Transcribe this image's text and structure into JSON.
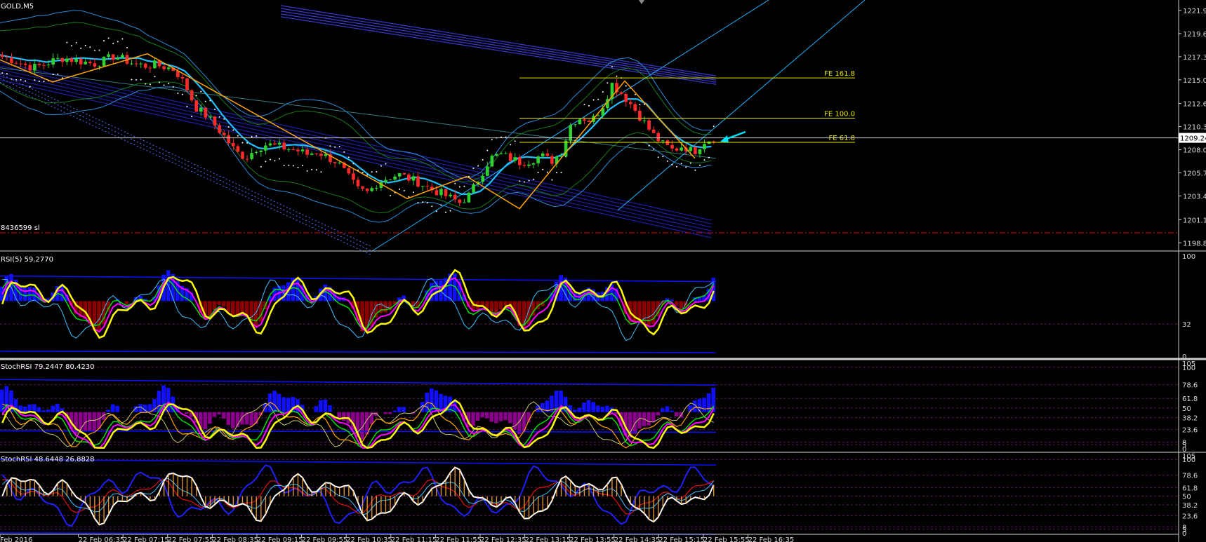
{
  "symbol_label": "GOLD,M5",
  "current_price": "1209.24",
  "sl_label": "8436599 sl",
  "colors": {
    "bull": "#2ed12e",
    "bear": "#ff2b2b",
    "fib": "#e8e800",
    "cyan": "#1fb3ff",
    "navy": "#2323c9",
    "yellow": "#ffff00",
    "magenta": "#ff00ff",
    "green": "#00e000",
    "histBlue": "#1010ff",
    "histRed": "#8a0000",
    "histPurple": "#8a008a",
    "orange": "#ffa400"
  },
  "fib_levels": [
    {
      "label": "FE 161.8",
      "price": 1215.2
    },
    {
      "label": "FE 100.0",
      "price": 1211.2
    },
    {
      "label": "FE 61.8",
      "price": 1208.8
    }
  ],
  "chart_data": [
    {
      "type": "candlestick",
      "title": "GOLD,M5",
      "y_ticks": [
        "1221.91",
        "1219.61",
        "1217.31",
        "1215.01",
        "1212.66",
        "1210.36",
        "1208.06",
        "1205.76",
        "1203.46",
        "1201.11",
        "1198.81"
      ],
      "ylim": [
        1198.81,
        1221.91
      ],
      "x_ticks": [
        "Feb 2016",
        "22 Feb 06:35",
        "22 Feb 07:15",
        "22 Feb 07:55",
        "22 Feb 08:35",
        "22 Feb 09:15",
        "22 Feb 09:55",
        "22 Feb 10:35",
        "22 Feb 11:15",
        "22 Feb 11:55",
        "22 Feb 12:35",
        "22 Feb 13:15",
        "22 Feb 13:55",
        "22 Feb 14:35",
        "22 Feb 15:15",
        "22 Feb 15:55",
        "22 Feb 16:35"
      ],
      "close_path": [
        1217.3,
        1217.0,
        1216.6,
        1216.2,
        1216.5,
        1216.9,
        1217.2,
        1217.0,
        1216.8,
        1216.6,
        1216.9,
        1217.4,
        1217.0,
        1216.6,
        1216.4,
        1216.5,
        1216.3,
        1216.0,
        1214.5,
        1212.3,
        1211.5,
        1210.4,
        1209.2,
        1207.8,
        1207.3,
        1208.2,
        1208.6,
        1208.4,
        1208.2,
        1208.0,
        1207.6,
        1207.9,
        1207.3,
        1206.8,
        1205.4,
        1204.1,
        1203.8,
        1204.9,
        1205.3,
        1205.6,
        1205.2,
        1204.8,
        1204.2,
        1203.8,
        1203.3,
        1202.8,
        1203.6,
        1205.4,
        1207.2,
        1207.6,
        1207.2,
        1206.8,
        1207.0,
        1207.5,
        1206.9,
        1207.8,
        1210.8,
        1211.3,
        1210.9,
        1212.3,
        1214.6,
        1213.6,
        1212.4,
        1211.0,
        1209.6,
        1208.6,
        1208.0,
        1208.5,
        1207.8,
        1208.9,
        1209.2
      ],
      "bar_count": 155,
      "current": 1209.24,
      "stop_loss": 1199.8
    },
    {
      "type": "line",
      "name": "RSI(5) 59.2770",
      "y_ticks": [
        "100",
        "32",
        "0"
      ],
      "ylim": [
        0,
        100
      ],
      "value": 59.277
    },
    {
      "type": "line",
      "name": "StochRSI 79.2447 80.4230",
      "y_ticks": [
        "105",
        "100",
        "78.6",
        "61.8",
        "50",
        "38.2",
        "23.6",
        "8",
        "5",
        "0"
      ],
      "ylim": [
        0,
        105
      ]
    },
    {
      "type": "line",
      "name": "StochRSI 48.6448 26.8828",
      "y_ticks": [
        "105",
        "100",
        "78.6",
        "61.8",
        "50",
        "38.2",
        "23.6",
        "8",
        "5",
        "0"
      ],
      "ylim": [
        0,
        105
      ]
    }
  ],
  "panels": {
    "rsi_label": "RSI(5) 59.2770",
    "stoch1_label": "StochRSI 79.2447 80.4230",
    "stoch2_label": "StochRSI 48.6448 26.8828"
  }
}
